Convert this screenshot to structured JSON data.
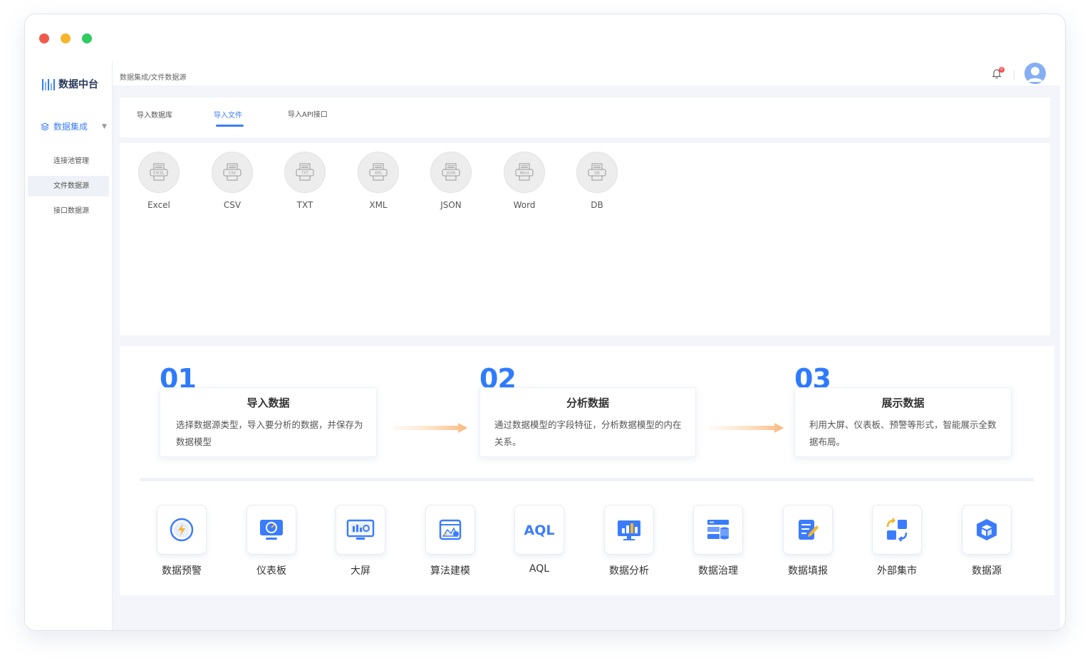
{
  "app": {
    "logo_text": "数据中台"
  },
  "sidebar": {
    "group_label": "数据集成",
    "items": [
      {
        "label": "连接池管理"
      },
      {
        "label": "文件数据源"
      },
      {
        "label": "接口数据源"
      }
    ]
  },
  "header": {
    "breadcrumb": "数据集成/文件数据源",
    "notification_count": "0"
  },
  "tabs": [
    {
      "label": "导入数据库"
    },
    {
      "label": "导入文件"
    },
    {
      "label": "导入API接口"
    }
  ],
  "file_types": [
    {
      "label": "Excel",
      "icon_text": "EXCEL"
    },
    {
      "label": "CSV",
      "icon_text": "CSV"
    },
    {
      "label": "TXT",
      "icon_text": "TXT"
    },
    {
      "label": "XML",
      "icon_text": "XML"
    },
    {
      "label": "JSON",
      "icon_text": "JSON"
    },
    {
      "label": "Word",
      "icon_text": "Word"
    },
    {
      "label": "DB",
      "icon_text": "DB"
    }
  ],
  "steps": [
    {
      "num": "01",
      "title": "导入数据",
      "desc": "选择数据源类型，导入要分析的数据，并保存为数据模型"
    },
    {
      "num": "02",
      "title": "分析数据",
      "desc": "通过数据模型的字段特征，分析数据模型的内在关系。"
    },
    {
      "num": "03",
      "title": "展示数据",
      "desc": "利用大屏、仪表板、预警等形式，智能展示全数据布局。"
    }
  ],
  "tools": [
    {
      "label": "数据预警",
      "icon": "alert-icon"
    },
    {
      "label": "仪表板",
      "icon": "dashboard-icon"
    },
    {
      "label": "大屏",
      "icon": "big-screen-icon"
    },
    {
      "label": "算法建模",
      "icon": "algorithm-icon"
    },
    {
      "label": "AQL",
      "icon": "aql-icon",
      "icon_text": "AQL"
    },
    {
      "label": "数据分析",
      "icon": "analysis-icon"
    },
    {
      "label": "数据治理",
      "icon": "governance-icon"
    },
    {
      "label": "数据填报",
      "icon": "fill-report-icon"
    },
    {
      "label": "外部集市",
      "icon": "market-icon"
    },
    {
      "label": "数据源",
      "icon": "datasource-icon"
    }
  ],
  "colors": {
    "accent": "#3b7cff",
    "traffic": [
      "#f05a4b",
      "#f7b52c",
      "#2ecc5e"
    ]
  }
}
